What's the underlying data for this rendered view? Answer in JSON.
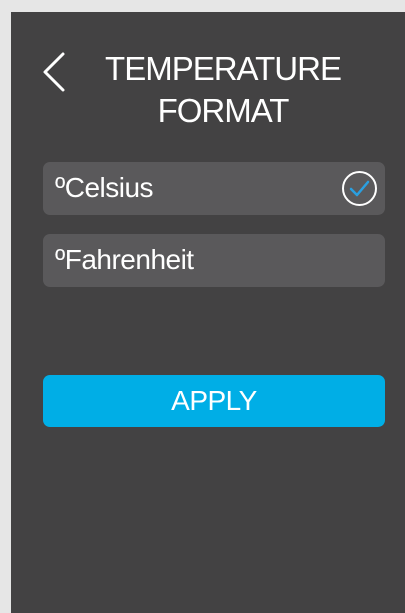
{
  "header": {
    "title_line1": "TEMPERATURE",
    "title_line2": "FORMAT",
    "back_icon": "chevron-left-icon"
  },
  "options": [
    {
      "label": "ºCelsius",
      "selected": true
    },
    {
      "label": "ºFahrenheit",
      "selected": false
    }
  ],
  "selected_icon": "check-circle-icon",
  "apply_label": "APPLY",
  "colors": {
    "background": "#434243",
    "option_background": "#5a595b",
    "accent": "#00aee6",
    "check": "#2a9fe0",
    "text": "#ffffff"
  }
}
